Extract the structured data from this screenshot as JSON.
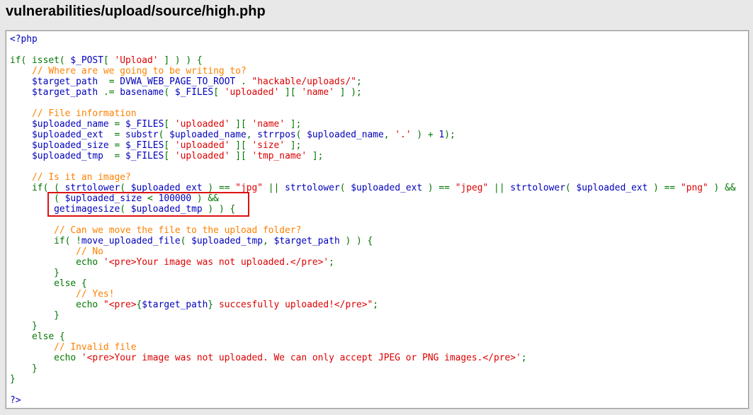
{
  "page": {
    "title": "vulnerabilities/upload/source/high.php"
  },
  "colors": {
    "keyword": "#007700",
    "variable": "#0000BB",
    "string": "#DD0000",
    "comment": "#FF8000",
    "highlight_border": "#dd1111"
  },
  "code": {
    "lines": [
      [
        {
          "t": "<?php",
          "c": "var"
        }
      ],
      [],
      [
        {
          "t": "if( isset( ",
          "c": "kw"
        },
        {
          "t": "$_POST",
          "c": "var"
        },
        {
          "t": "[ ",
          "c": "kw"
        },
        {
          "t": "'Upload'",
          "c": "str"
        },
        {
          "t": " ] ) ) {",
          "c": "kw"
        }
      ],
      [
        {
          "t": "    // Where are we going to be writing to?",
          "c": "com"
        }
      ],
      [
        {
          "t": "    $target_path",
          "c": "var"
        },
        {
          "t": "  = ",
          "c": "kw"
        },
        {
          "t": "DVWA_WEB_PAGE_TO_ROOT",
          "c": "var"
        },
        {
          "t": " . ",
          "c": "kw"
        },
        {
          "t": "\"hackable/uploads/\"",
          "c": "str"
        },
        {
          "t": ";",
          "c": "kw"
        }
      ],
      [
        {
          "t": "    $target_path",
          "c": "var"
        },
        {
          "t": " .= ",
          "c": "kw"
        },
        {
          "t": "basename",
          "c": "var"
        },
        {
          "t": "( ",
          "c": "kw"
        },
        {
          "t": "$_FILES",
          "c": "var"
        },
        {
          "t": "[ ",
          "c": "kw"
        },
        {
          "t": "'uploaded'",
          "c": "str"
        },
        {
          "t": " ][ ",
          "c": "kw"
        },
        {
          "t": "'name'",
          "c": "str"
        },
        {
          "t": " ] );",
          "c": "kw"
        }
      ],
      [],
      [
        {
          "t": "    // File information",
          "c": "com"
        }
      ],
      [
        {
          "t": "    $uploaded_name",
          "c": "var"
        },
        {
          "t": " = ",
          "c": "kw"
        },
        {
          "t": "$_FILES",
          "c": "var"
        },
        {
          "t": "[ ",
          "c": "kw"
        },
        {
          "t": "'uploaded'",
          "c": "str"
        },
        {
          "t": " ][ ",
          "c": "kw"
        },
        {
          "t": "'name'",
          "c": "str"
        },
        {
          "t": " ];",
          "c": "kw"
        }
      ],
      [
        {
          "t": "    $uploaded_ext",
          "c": "var"
        },
        {
          "t": "  = ",
          "c": "kw"
        },
        {
          "t": "substr",
          "c": "var"
        },
        {
          "t": "( ",
          "c": "kw"
        },
        {
          "t": "$uploaded_name",
          "c": "var"
        },
        {
          "t": ", ",
          "c": "kw"
        },
        {
          "t": "strrpos",
          "c": "var"
        },
        {
          "t": "( ",
          "c": "kw"
        },
        {
          "t": "$uploaded_name",
          "c": "var"
        },
        {
          "t": ", ",
          "c": "kw"
        },
        {
          "t": "'.'",
          "c": "str"
        },
        {
          "t": " ) + ",
          "c": "kw"
        },
        {
          "t": "1",
          "c": "var"
        },
        {
          "t": ");",
          "c": "kw"
        }
      ],
      [
        {
          "t": "    $uploaded_size",
          "c": "var"
        },
        {
          "t": " = ",
          "c": "kw"
        },
        {
          "t": "$_FILES",
          "c": "var"
        },
        {
          "t": "[ ",
          "c": "kw"
        },
        {
          "t": "'uploaded'",
          "c": "str"
        },
        {
          "t": " ][ ",
          "c": "kw"
        },
        {
          "t": "'size'",
          "c": "str"
        },
        {
          "t": " ];",
          "c": "kw"
        }
      ],
      [
        {
          "t": "    $uploaded_tmp",
          "c": "var"
        },
        {
          "t": "  = ",
          "c": "kw"
        },
        {
          "t": "$_FILES",
          "c": "var"
        },
        {
          "t": "[ ",
          "c": "kw"
        },
        {
          "t": "'uploaded'",
          "c": "str"
        },
        {
          "t": " ][ ",
          "c": "kw"
        },
        {
          "t": "'tmp_name'",
          "c": "str"
        },
        {
          "t": " ];",
          "c": "kw"
        }
      ],
      [],
      [
        {
          "t": "    // Is it an image?",
          "c": "com"
        }
      ],
      [
        {
          "t": "    if( ( ",
          "c": "kw"
        },
        {
          "t": "strtolower",
          "c": "var"
        },
        {
          "t": "( ",
          "c": "kw"
        },
        {
          "t": "$uploaded_ext",
          "c": "var"
        },
        {
          "t": " ) == ",
          "c": "kw"
        },
        {
          "t": "\"jpg\"",
          "c": "str"
        },
        {
          "t": " || ",
          "c": "kw"
        },
        {
          "t": "strtolower",
          "c": "var"
        },
        {
          "t": "( ",
          "c": "kw"
        },
        {
          "t": "$uploaded_ext",
          "c": "var"
        },
        {
          "t": " ) == ",
          "c": "kw"
        },
        {
          "t": "\"jpeg\"",
          "c": "str"
        },
        {
          "t": " || ",
          "c": "kw"
        },
        {
          "t": "strtolower",
          "c": "var"
        },
        {
          "t": "( ",
          "c": "kw"
        },
        {
          "t": "$uploaded_ext",
          "c": "var"
        },
        {
          "t": " ) == ",
          "c": "kw"
        },
        {
          "t": "\"png\"",
          "c": "str"
        },
        {
          "t": " ) &&",
          "c": "kw"
        }
      ],
      [
        {
          "t": "        ( ",
          "c": "kw"
        },
        {
          "t": "$uploaded_size",
          "c": "var"
        },
        {
          "t": " < ",
          "c": "kw"
        },
        {
          "t": "100000",
          "c": "var"
        },
        {
          "t": " ) &&",
          "c": "kw"
        }
      ],
      [
        {
          "t": "        getimagesize",
          "c": "var"
        },
        {
          "t": "( ",
          "c": "kw"
        },
        {
          "t": "$uploaded_tmp",
          "c": "var"
        },
        {
          "t": " ) ) {",
          "c": "kw"
        }
      ],
      [],
      [
        {
          "t": "        // Can we move the file to the upload folder?",
          "c": "com"
        }
      ],
      [
        {
          "t": "        if( !",
          "c": "kw"
        },
        {
          "t": "move_uploaded_file",
          "c": "var"
        },
        {
          "t": "( ",
          "c": "kw"
        },
        {
          "t": "$uploaded_tmp",
          "c": "var"
        },
        {
          "t": ", ",
          "c": "kw"
        },
        {
          "t": "$target_path",
          "c": "var"
        },
        {
          "t": " ) ) {",
          "c": "kw"
        }
      ],
      [
        {
          "t": "            // No",
          "c": "com"
        }
      ],
      [
        {
          "t": "            echo ",
          "c": "kw"
        },
        {
          "t": "'<pre>Your image was not uploaded.</pre>'",
          "c": "str"
        },
        {
          "t": ";",
          "c": "kw"
        }
      ],
      [
        {
          "t": "        }",
          "c": "kw"
        }
      ],
      [
        {
          "t": "        else {",
          "c": "kw"
        }
      ],
      [
        {
          "t": "            // Yes!",
          "c": "com"
        }
      ],
      [
        {
          "t": "            echo ",
          "c": "kw"
        },
        {
          "t": "\"<pre>",
          "c": "str"
        },
        {
          "t": "{",
          "c": "kw"
        },
        {
          "t": "$target_path",
          "c": "var"
        },
        {
          "t": "}",
          "c": "kw"
        },
        {
          "t": " succesfully uploaded!</pre>\"",
          "c": "str"
        },
        {
          "t": ";",
          "c": "kw"
        }
      ],
      [
        {
          "t": "        }",
          "c": "kw"
        }
      ],
      [
        {
          "t": "    }",
          "c": "kw"
        }
      ],
      [
        {
          "t": "    else {",
          "c": "kw"
        }
      ],
      [
        {
          "t": "        // Invalid file",
          "c": "com"
        }
      ],
      [
        {
          "t": "        echo ",
          "c": "kw"
        },
        {
          "t": "'<pre>Your image was not uploaded. We can only accept JPEG or PNG images.</pre>'",
          "c": "str"
        },
        {
          "t": ";",
          "c": "kw"
        }
      ],
      [
        {
          "t": "    }",
          "c": "kw"
        }
      ],
      [
        {
          "t": "}",
          "c": "kw"
        }
      ],
      [],
      [
        {
          "t": "?>",
          "c": "var"
        }
      ]
    ]
  }
}
